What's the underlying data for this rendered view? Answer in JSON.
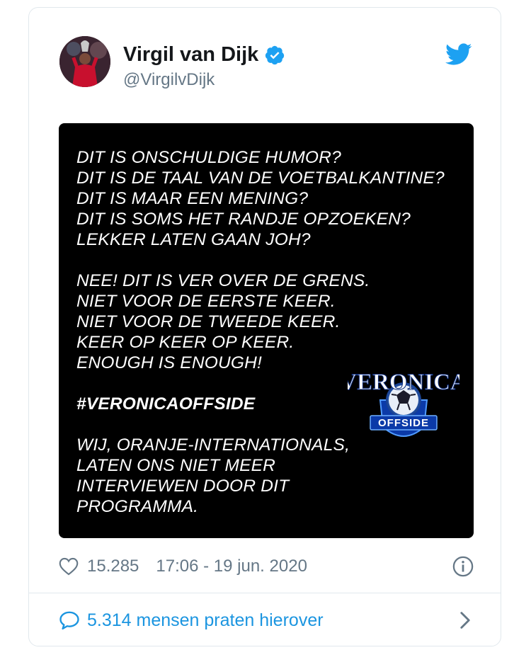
{
  "tweet": {
    "author_name": "Virgil van Dijk",
    "author_handle": "@VirgilvDijk",
    "verified": true,
    "image_text": [
      "DIT IS ONSCHULDIGE HUMOR?",
      "DIT IS DE TAAL VAN DE VOETBALKANTINE?",
      "DIT IS MAAR EEN MENING?",
      "DIT IS SOMS HET RANDJE OPZOEKEN?",
      "LEKKER LATEN GAAN JOH?",
      "",
      "NEE! DIT IS VER OVER DE GRENS.",
      "NIET VOOR DE EERSTE KEER.",
      "NIET VOOR DE TWEEDE KEER.",
      "KEER OP KEER OP KEER.",
      "ENOUGH IS ENOUGH!",
      "",
      "#VERONICAOFFSIDE",
      "",
      "WIJ, ORANJE-INTERNATIONALS,",
      "LATEN ONS NIET MEER",
      "INTERVIEWEN DOOR DIT",
      "PROGRAMMA."
    ],
    "logo_text_top": "VERONICA",
    "logo_text_bottom": "OFFSIDE",
    "likes": "15.285",
    "timestamp": "17:06 - 19 jun. 2020",
    "conversation_text": "5.314 mensen praten hierover"
  },
  "colors": {
    "twitter_blue": "#1da1f2",
    "link_blue": "#1b95e0",
    "secondary_text": "#657786",
    "border": "#e1e8ed"
  },
  "icons": [
    "twitter-bird-icon",
    "verified-badge-icon",
    "heart-icon",
    "info-icon",
    "reply-bubble-icon",
    "chevron-right-icon"
  ]
}
